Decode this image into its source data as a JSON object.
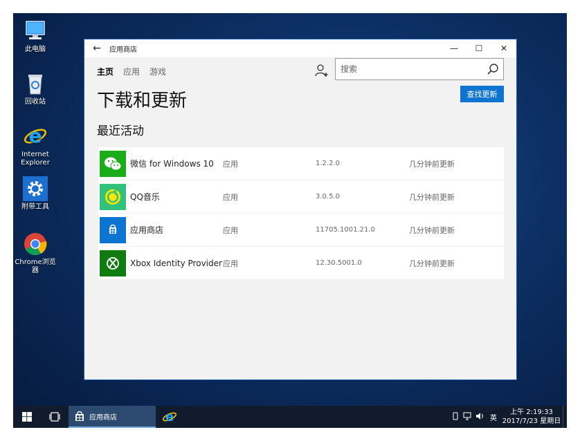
{
  "desktop": {
    "icons": [
      {
        "label": "此电脑",
        "icon": "computer-icon"
      },
      {
        "label": "回收站",
        "icon": "recycle-bin-icon"
      },
      {
        "label": "Internet Explorer",
        "icon": "ie-icon"
      },
      {
        "label": "附带工具",
        "icon": "gear-icon"
      },
      {
        "label": "Chrome浏览器",
        "icon": "chrome-icon"
      }
    ]
  },
  "window": {
    "title": "应用商店",
    "controls": {
      "minimize": "—",
      "maximize": "☐",
      "close": "✕"
    },
    "back": "←"
  },
  "nav": {
    "items": [
      "主页",
      "应用",
      "游戏"
    ]
  },
  "search": {
    "placeholder": "搜索",
    "value": ""
  },
  "page": {
    "title": "下载和更新",
    "check_button": "查找更新",
    "section_title": "最近活动"
  },
  "activity": [
    {
      "name": "微信 for Windows 10",
      "kind": "应用",
      "version": "1.2.2.0",
      "status": "几分钟前更新",
      "icon": "wechat-icon",
      "color": "#1aad19"
    },
    {
      "name": "QQ音乐",
      "kind": "应用",
      "version": "3.0.5.0",
      "status": "几分钟前更新",
      "icon": "qq-music-icon",
      "color": "#31c27c"
    },
    {
      "name": "应用商店",
      "kind": "应用",
      "version": "11705.1001.21.0",
      "status": "几分钟前更新",
      "icon": "store-icon",
      "color": "#0e74d1"
    },
    {
      "name": "Xbox Identity Provider",
      "kind": "应用",
      "version": "12.30.5001.0",
      "status": "几分钟前更新",
      "icon": "xbox-icon",
      "color": "#107c10"
    }
  ],
  "taskbar": {
    "active_app": "应用商店",
    "tray": {
      "lang": "英",
      "time": "上午 2:19:33",
      "date": "2017/7/23 星期日"
    }
  }
}
